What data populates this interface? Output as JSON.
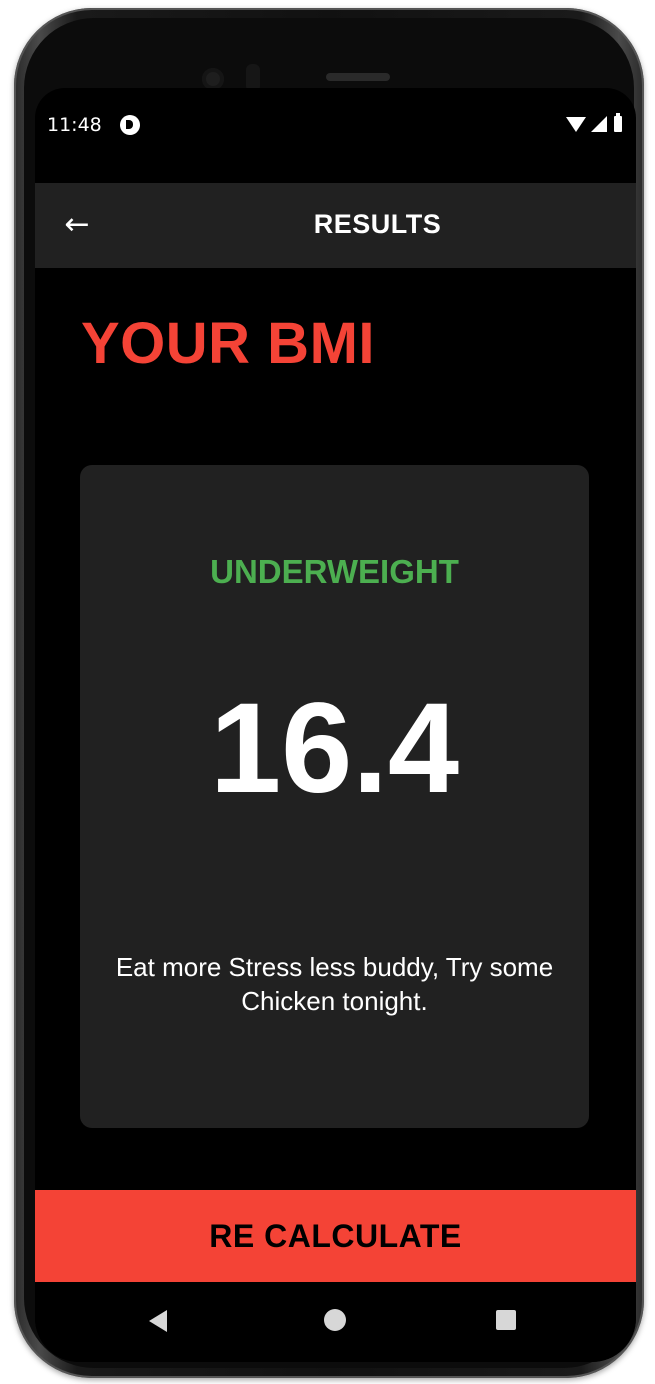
{
  "status_bar": {
    "time": "11:48"
  },
  "app_bar": {
    "title": "RESULTS",
    "back_icon": "arrow-left-icon"
  },
  "page": {
    "heading": "YOUR BMI"
  },
  "result": {
    "category": "UNDERWEIGHT",
    "bmi_value": "16.4",
    "message": "Eat more Stress less buddy, Try some Chicken tonight."
  },
  "actions": {
    "recalculate_label": "RE CALCULATE"
  },
  "colors": {
    "accent": "#f44336",
    "category": "#4caf50",
    "card": "#212121",
    "background": "#000000"
  },
  "nav_bar": {
    "icons": [
      "nav-back-icon",
      "nav-home-icon",
      "nav-recents-icon"
    ]
  }
}
